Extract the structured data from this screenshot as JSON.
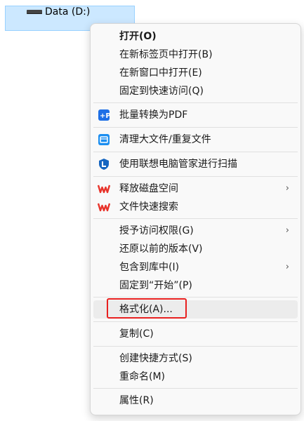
{
  "drive": {
    "label": "Data (D:)",
    "icon": "drive-icon"
  },
  "menu": {
    "items": [
      {
        "id": "open",
        "label": "打开(O)",
        "bold": true
      },
      {
        "id": "open-new-tab",
        "label": "在新标签页中打开(B)"
      },
      {
        "id": "open-new-window",
        "label": "在新窗口中打开(E)"
      },
      {
        "id": "pin-quick-access",
        "label": "固定到快速访问(Q)"
      },
      {
        "id": "batch-pdf",
        "label": "批量转换为PDF",
        "icon": "pdf-convert-icon"
      },
      {
        "id": "clean-files",
        "label": "清理大文件/重复文件",
        "icon": "cleanup-icon"
      },
      {
        "id": "lenovo-scan",
        "label": "使用联想电脑管家进行扫描",
        "icon": "lenovo-shield-icon"
      },
      {
        "id": "free-space",
        "label": "释放磁盘空间",
        "icon": "wps-icon",
        "submenu": true
      },
      {
        "id": "quick-search",
        "label": "文件快速搜索",
        "icon": "wps-icon"
      },
      {
        "id": "grant-access",
        "label": "授予访问权限(G)",
        "submenu": true
      },
      {
        "id": "restore-versions",
        "label": "还原以前的版本(V)"
      },
      {
        "id": "include-library",
        "label": "包含到库中(I)",
        "submenu": true
      },
      {
        "id": "pin-start",
        "label": "固定到“开始”(P)"
      },
      {
        "id": "format",
        "label": "格式化(A)...",
        "highlighted": true
      },
      {
        "id": "copy",
        "label": "复制(C)"
      },
      {
        "id": "create-shortcut",
        "label": "创建快捷方式(S)"
      },
      {
        "id": "rename",
        "label": "重命名(M)"
      },
      {
        "id": "properties",
        "label": "属性(R)"
      }
    ],
    "submenu_arrow": "›"
  },
  "colors": {
    "selection": "#cce8ff",
    "highlight_border": "#e8201f",
    "wps_red": "#e8332a",
    "pdf_blue": "#1e6fe6",
    "cleanup_blue": "#1c8ef0",
    "lenovo_blue": "#1565c0"
  }
}
